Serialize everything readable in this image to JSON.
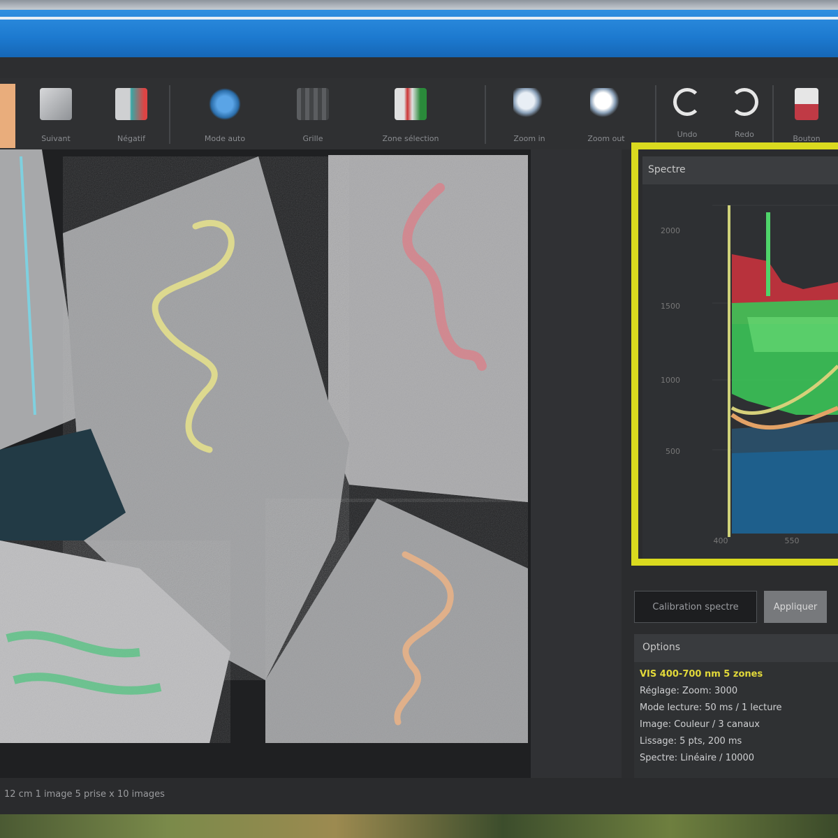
{
  "toolbar": {
    "buttons": [
      {
        "label": "Suivant",
        "icon": "layers-icon"
      },
      {
        "label": "Négatif",
        "icon": "image-icon"
      },
      {
        "label": "Mode auto",
        "icon": "auto-icon"
      },
      {
        "label": "Grille",
        "icon": "grid-icon"
      },
      {
        "label": "Zone sélection",
        "icon": "selection-icon"
      },
      {
        "label": "Zoom in",
        "icon": "zoom-in-icon"
      },
      {
        "label": "Zoom out",
        "icon": "zoom-out-icon"
      },
      {
        "label": "Undo",
        "icon": "undo-icon"
      },
      {
        "label": "Redo",
        "icon": "redo-icon"
      },
      {
        "label": "Bouton",
        "icon": "tool-icon"
      }
    ]
  },
  "histogram": {
    "title": "Spectre",
    "y_ticks": [
      "2000",
      "1500",
      "1000",
      "500"
    ],
    "x_ticks": [
      "400",
      "550"
    ],
    "colors": {
      "red": "#b8323c",
      "green": "#3bc357",
      "blue": "#1e5f8c",
      "line": "#d6d07a",
      "orange": "#e3a266"
    }
  },
  "panel": {
    "calibrate_label": "Calibration spectre",
    "apply_label": "Appliquer",
    "options_title": "Options",
    "lines": [
      "VIS 400-700 nm 5 zones",
      "Réglage: Zoom: 3000",
      "Mode lecture: 50 ms / 1 lecture",
      "Image: Couleur / 3 canaux",
      "Lissage: 5 pts, 200 ms",
      "Spectre: Linéaire / 10000"
    ]
  },
  "status": {
    "text": "12 cm 1 image 5 prise x 10 images"
  }
}
